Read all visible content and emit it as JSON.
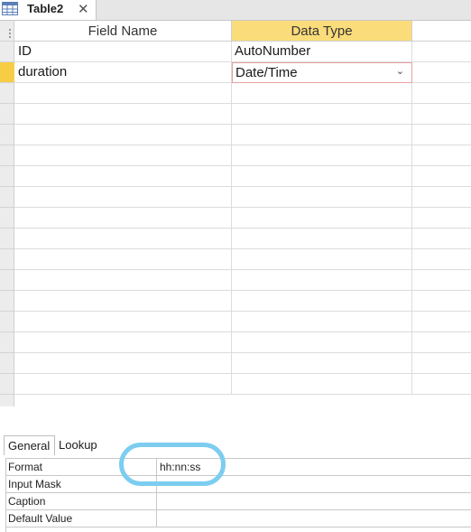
{
  "tab": {
    "title": "Table2",
    "icon": "table-icon",
    "close_glyph": "✕"
  },
  "grid": {
    "columns": [
      "Field Name",
      "Data Type"
    ],
    "rows": [
      {
        "field_name": "ID",
        "data_type": "AutoNumber"
      },
      {
        "field_name": "duration",
        "data_type": "Date/Time",
        "active": true
      }
    ]
  },
  "properties": {
    "tabs": [
      "General",
      "Lookup"
    ],
    "active_tab": "General",
    "rows": [
      {
        "label": "Format",
        "value": "hh:nn:ss"
      },
      {
        "label": "Input Mask",
        "value": ""
      },
      {
        "label": "Caption",
        "value": ""
      },
      {
        "label": "Default Value",
        "value": ""
      }
    ]
  },
  "colors": {
    "active_header": "#fbdc7a",
    "active_row_selector": "#f7cd46",
    "annotation": "#7ccdf0"
  }
}
